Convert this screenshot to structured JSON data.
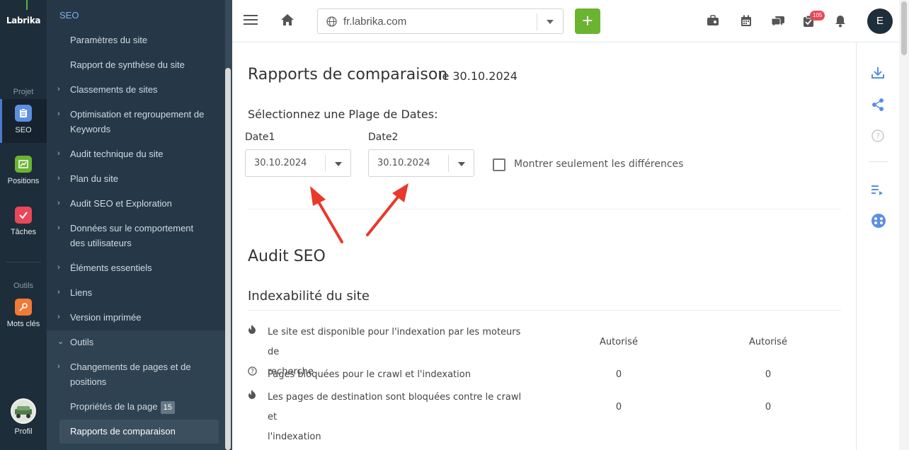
{
  "rail": {
    "logo": "Labrika",
    "group_projet": "Projet",
    "group_outils": "Outils",
    "items": [
      {
        "label": "SEO",
        "icon": "clipboard-icon",
        "color": "#5b8fe0"
      },
      {
        "label": "Positions",
        "icon": "chart-icon",
        "color": "#6bb432"
      },
      {
        "label": "Tâches",
        "icon": "check-icon",
        "color": "#e8485a"
      },
      {
        "label": "Mots clés",
        "icon": "key-icon",
        "color": "#f07a36"
      }
    ],
    "profile": "Profil"
  },
  "sidebar": {
    "heading": "SEO",
    "items": [
      {
        "label": "Paramètres du site",
        "chevron": false
      },
      {
        "label": "Rapport de synthèse du site",
        "chevron": false
      },
      {
        "label": "Classements de sites",
        "chevron": true
      },
      {
        "label": "Optimisation et regroupement de",
        "label2": "Keywords",
        "chevron": true
      },
      {
        "label": "Audit technique du site",
        "chevron": true
      },
      {
        "label": "Plan du site",
        "chevron": true
      },
      {
        "label": "Audit SEO et Exploration",
        "chevron": true
      },
      {
        "label": "Données sur le comportement",
        "label2": "des utilisateurs",
        "chevron": true
      },
      {
        "label": "Éléments essentiels",
        "chevron": true
      },
      {
        "label": "Liens",
        "chevron": true
      },
      {
        "label": "Version imprimée",
        "chevron": true
      },
      {
        "label": "Outils",
        "chevron": true,
        "expanded": true
      },
      {
        "label": "Changements de pages et de",
        "label2": "positions",
        "chevron": true
      },
      {
        "label": "Propriétés de la page",
        "badge": "15",
        "chevron": false
      },
      {
        "label": "Rapports de comparaison",
        "chevron": false,
        "active": true
      }
    ]
  },
  "topbar": {
    "url": "fr.labrika.com",
    "notif_count": "105",
    "user_initial": "E"
  },
  "page": {
    "title": "Rapports de comparaison",
    "date": "le 30.10.2024",
    "select_title": "Sélectionnez une Plage de Dates:",
    "date1_label": "Date1",
    "date1_value": "30.10.2024",
    "date2_label": "Date2",
    "date2_value": "30.10.2024",
    "only_diff_label": "Montrer seulement les différences",
    "section": "Audit SEO",
    "subsection": "Indexabilité du site",
    "rows": [
      {
        "icon": "fire-icon",
        "label": "Le site est disponible pour l'indexation par les moteurs de",
        "label2": "recherche",
        "v1": "Autorisé",
        "v2": "Autorisé"
      },
      {
        "icon": "question-icon",
        "label": "Pages bloquées pour le crawl et l'indexation",
        "v1": "0",
        "v2": "0"
      },
      {
        "icon": "fire-icon",
        "label": "Les pages de destination sont bloquées contre le crawl et",
        "label2": "l'indexation",
        "v1": "0",
        "v2": "0"
      }
    ]
  }
}
